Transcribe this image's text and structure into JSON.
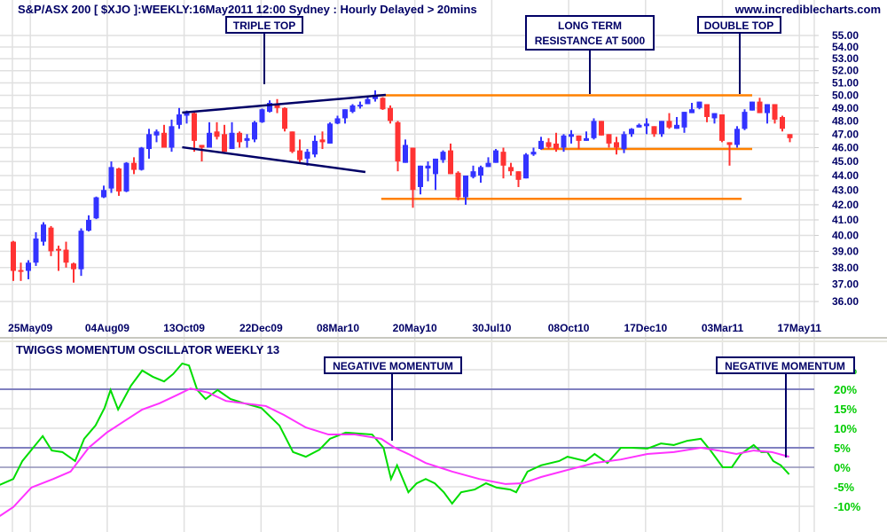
{
  "header": {
    "title": "S&P/ASX 200 [ $XJO ]:WEEKLY:16May2011 12:00 Sydney : Hourly Delayed > 20mins",
    "website": "www.incrediblecharts.com"
  },
  "annotations": {
    "triple_top": "TRIPLE TOP",
    "resistance_line1": "LONG TERM",
    "resistance_line2": "RESISTANCE AT 5000",
    "double_top": "DOUBLE TOP",
    "negative_momentum_1": "NEGATIVE MOMENTUM",
    "negative_momentum_2": "NEGATIVE MOMENTUM"
  },
  "oscillator": {
    "title": "TWIGGS MOMENTUM OSCILLATOR WEEKLY 13"
  },
  "colors": {
    "up": "#3333ff",
    "down": "#ff3333",
    "trendline": "#000066",
    "level": "#ff8000",
    "momentum": "#00dd00",
    "signal": "#ff33ff",
    "osc_level": "#8080c0"
  },
  "chart_data": [
    {
      "type": "candlestick",
      "title": "S&P/ASX 200 [ $XJO ]:WEEKLY",
      "scale": "log",
      "ylim": [
        3600,
        5500
      ],
      "y_ticks": [
        5500,
        5400,
        5300,
        5200,
        5100,
        5000,
        4900,
        4800,
        4700,
        4600,
        4500,
        4400,
        4300,
        4200,
        4100,
        4000,
        3900,
        3800,
        3700,
        3600
      ],
      "y_tick_labels": [
        "55.00",
        "54.00",
        "53.00",
        "52.00",
        "51.00",
        "50.00",
        "49.00",
        "48.00",
        "47.00",
        "46.00",
        "45.00",
        "44.00",
        "43.00",
        "42.00",
        "41.00",
        "40.00",
        "39.00",
        "38.00",
        "37.00",
        "36.00"
      ],
      "x_ticks": [
        1.2,
        11.4,
        21.6,
        31.8,
        42,
        52.2,
        62.4,
        72.6,
        82.8,
        93,
        103.2
      ],
      "x_tick_labels": [
        "25May09",
        "04Aug09",
        "13Oct09",
        "22Dec09",
        "08Mar10",
        "20May10",
        "30Jul10",
        "08Oct10",
        "17Dec10",
        "03Mar11",
        "17May11"
      ],
      "ohlc_fields": [
        "open",
        "high",
        "low",
        "close"
      ],
      "ohlc": [
        [
          3960,
          3965,
          3720,
          3780
        ],
        [
          3785,
          3830,
          3720,
          3775
        ],
        [
          3780,
          3845,
          3730,
          3830
        ],
        [
          3830,
          4020,
          3810,
          3980
        ],
        [
          3960,
          4085,
          3935,
          4070
        ],
        [
          4050,
          4060,
          3870,
          3900
        ],
        [
          3915,
          3935,
          3780,
          3905
        ],
        [
          3910,
          3960,
          3800,
          3830
        ],
        [
          3825,
          3830,
          3710,
          3790
        ],
        [
          3790,
          4045,
          3750,
          4030
        ],
        [
          4030,
          4130,
          4025,
          4100
        ],
        [
          4110,
          4255,
          4105,
          4250
        ],
        [
          4250,
          4330,
          4245,
          4300
        ],
        [
          4310,
          4500,
          4280,
          4460
        ],
        [
          4450,
          4455,
          4260,
          4290
        ],
        [
          4290,
          4495,
          4285,
          4490
        ],
        [
          4490,
          4530,
          4410,
          4440
        ],
        [
          4440,
          4605,
          4435,
          4600
        ],
        [
          4590,
          4740,
          4520,
          4700
        ],
        [
          4690,
          4735,
          4640,
          4720
        ],
        [
          4710,
          4770,
          4600,
          4600
        ],
        [
          4600,
          4810,
          4570,
          4760
        ],
        [
          4770,
          4900,
          4740,
          4850
        ],
        [
          4840,
          4880,
          4780,
          4870
        ],
        [
          4860,
          4870,
          4570,
          4650
        ],
        [
          4620,
          4620,
          4500,
          4600
        ],
        [
          4600,
          4790,
          4600,
          4710
        ],
        [
          4720,
          4790,
          4660,
          4680
        ],
        [
          4700,
          4770,
          4570,
          4570
        ],
        [
          4590,
          4790,
          4590,
          4710
        ],
        [
          4710,
          4720,
          4600,
          4640
        ],
        [
          4650,
          4700,
          4600,
          4670
        ],
        [
          4660,
          4800,
          4640,
          4790
        ],
        [
          4790,
          4895,
          4785,
          4890
        ],
        [
          4870,
          4960,
          4865,
          4940
        ],
        [
          4930,
          4970,
          4860,
          4900
        ],
        [
          4900,
          4905,
          4720,
          4740
        ],
        [
          4720,
          4720,
          4560,
          4570
        ],
        [
          4580,
          4660,
          4490,
          4510
        ],
        [
          4520,
          4590,
          4470,
          4570
        ],
        [
          4550,
          4690,
          4530,
          4650
        ],
        [
          4660,
          4720,
          4590,
          4640
        ],
        [
          4630,
          4790,
          4630,
          4780
        ],
        [
          4780,
          4840,
          4775,
          4820
        ],
        [
          4820,
          4890,
          4780,
          4890
        ],
        [
          4870,
          4930,
          4860,
          4920
        ],
        [
          4915,
          4950,
          4895,
          4925
        ],
        [
          4930,
          4985,
          4930,
          4970
        ],
        [
          4970,
          5040,
          4950,
          5005
        ],
        [
          4980,
          4985,
          4885,
          4890
        ],
        [
          4900,
          4920,
          4780,
          4800
        ],
        [
          4790,
          4800,
          4430,
          4500
        ],
        [
          4490,
          4660,
          4490,
          4620
        ],
        [
          4600,
          4600,
          4180,
          4300
        ],
        [
          4320,
          4470,
          4270,
          4470
        ],
        [
          4450,
          4500,
          4360,
          4470
        ],
        [
          4410,
          4520,
          4300,
          4520
        ],
        [
          4510,
          4580,
          4490,
          4570
        ],
        [
          4580,
          4630,
          4410,
          4410
        ],
        [
          4420,
          4430,
          4230,
          4250
        ],
        [
          4250,
          4400,
          4200,
          4400
        ],
        [
          4390,
          4470,
          4380,
          4430
        ],
        [
          4400,
          4470,
          4350,
          4460
        ],
        [
          4460,
          4530,
          4460,
          4490
        ],
        [
          4490,
          4590,
          4490,
          4580
        ],
        [
          4570,
          4600,
          4380,
          4470
        ],
        [
          4460,
          4490,
          4400,
          4430
        ],
        [
          4430,
          4430,
          4320,
          4370
        ],
        [
          4380,
          4560,
          4380,
          4550
        ],
        [
          4550,
          4600,
          4540,
          4570
        ],
        [
          4590,
          4680,
          4585,
          4650
        ],
        [
          4640,
          4670,
          4590,
          4605
        ],
        [
          4630,
          4710,
          4570,
          4590
        ],
        [
          4600,
          4700,
          4570,
          4690
        ],
        [
          4680,
          4730,
          4630,
          4700
        ],
        [
          4690,
          4690,
          4590,
          4650
        ],
        [
          4650,
          4720,
          4650,
          4670
        ],
        [
          4670,
          4820,
          4660,
          4800
        ],
        [
          4800,
          4800,
          4690,
          4690
        ],
        [
          4700,
          4700,
          4600,
          4630
        ],
        [
          4640,
          4680,
          4550,
          4600
        ],
        [
          4590,
          4720,
          4560,
          4700
        ],
        [
          4700,
          4745,
          4680,
          4740
        ],
        [
          4750,
          4780,
          4750,
          4770
        ],
        [
          4760,
          4820,
          4700,
          4780
        ],
        [
          4760,
          4760,
          4680,
          4700
        ],
        [
          4700,
          4800,
          4680,
          4800
        ],
        [
          4800,
          4860,
          4740,
          4750
        ],
        [
          4740,
          4830,
          4740,
          4770
        ],
        [
          4750,
          4870,
          4710,
          4870
        ],
        [
          4860,
          4940,
          4860,
          4890
        ],
        [
          4900,
          4950,
          4890,
          4950
        ],
        [
          4930,
          4930,
          4790,
          4830
        ],
        [
          4820,
          4860,
          4780,
          4860
        ],
        [
          4850,
          4850,
          4640,
          4650
        ],
        [
          4640,
          4640,
          4470,
          4620
        ],
        [
          4620,
          4760,
          4600,
          4740
        ],
        [
          4740,
          4890,
          4730,
          4870
        ],
        [
          4880,
          4950,
          4880,
          4950
        ],
        [
          4950,
          4980,
          4860,
          4860
        ],
        [
          4860,
          4930,
          4780,
          4930
        ],
        [
          4930,
          4930,
          4780,
          4810
        ],
        [
          4830,
          4840,
          4720,
          4740
        ],
        [
          4700,
          4700,
          4640,
          4670
        ]
      ],
      "trendlines": [
        {
          "name": "triple-top-upper",
          "from": [
            22.4,
            4864
          ],
          "to": [
            49.4,
            5003
          ]
        },
        {
          "name": "triple-top-lower",
          "from": [
            22.4,
            4603
          ],
          "to": [
            46.7,
            4425
          ]
        }
      ],
      "levels": [
        {
          "name": "resistance-5000",
          "value": 5000,
          "from": 48.2,
          "to": 98
        },
        {
          "name": "support-4590",
          "value": 4590,
          "from": 70,
          "to": 98
        },
        {
          "name": "support-4240",
          "value": 4240,
          "from": 48.8,
          "to": 96.6
        }
      ]
    },
    {
      "type": "line",
      "title": "TWIGGS MOMENTUM OSCILLATOR WEEKLY 13",
      "ylim": [
        -13,
        27
      ],
      "y_ticks": [
        25,
        20,
        15,
        10,
        5,
        0,
        -5,
        -10
      ],
      "y_tick_labels": [
        "25%",
        "20%",
        "15%",
        "10%",
        "5%",
        "0%",
        "-5%",
        "-10%"
      ],
      "reference_lines": [
        20,
        5,
        0
      ],
      "series": [
        {
          "name": "momentum",
          "points": [
            [
              -1.8,
              -4.5
            ],
            [
              0,
              -3
            ],
            [
              1.2,
              1.6
            ],
            [
              3.9,
              8
            ],
            [
              5.1,
              4.3
            ],
            [
              6.5,
              3.9
            ],
            [
              8.2,
              1.6
            ],
            [
              9.4,
              7.3
            ],
            [
              10.9,
              10.7
            ],
            [
              12.1,
              15.2
            ],
            [
              12.9,
              19.8
            ],
            [
              13.9,
              14.8
            ],
            [
              15.6,
              20.9
            ],
            [
              17.1,
              24.8
            ],
            [
              18.5,
              23.2
            ],
            [
              20,
              22
            ],
            [
              21.2,
              23.9
            ],
            [
              22.4,
              26.6
            ],
            [
              23.3,
              26.1
            ],
            [
              24.4,
              19.8
            ],
            [
              25.5,
              17.5
            ],
            [
              27.1,
              19.8
            ],
            [
              28.8,
              17.5
            ],
            [
              30.6,
              16.4
            ],
            [
              32.9,
              15.2
            ],
            [
              35.3,
              10.7
            ],
            [
              37.1,
              3.9
            ],
            [
              38.8,
              2.7
            ],
            [
              40.6,
              4.5
            ],
            [
              42,
              7.3
            ],
            [
              44.1,
              8.9
            ],
            [
              47.6,
              8.4
            ],
            [
              49.1,
              5
            ],
            [
              50.1,
              -3
            ],
            [
              50.9,
              0.5
            ],
            [
              52.4,
              -6.4
            ],
            [
              53.5,
              -4.1
            ],
            [
              54.7,
              -3
            ],
            [
              55.9,
              -4.1
            ],
            [
              57.1,
              -6.4
            ],
            [
              58.2,
              -9.3
            ],
            [
              59.4,
              -6.4
            ],
            [
              61.2,
              -5.7
            ],
            [
              62.7,
              -4.1
            ],
            [
              64.1,
              -5.2
            ],
            [
              65.9,
              -5.7
            ],
            [
              66.7,
              -6.4
            ],
            [
              68.2,
              -1.1
            ],
            [
              70,
              0.5
            ],
            [
              72.4,
              1.6
            ],
            [
              73.5,
              2.7
            ],
            [
              75.9,
              1.6
            ],
            [
              77.1,
              3.4
            ],
            [
              78.8,
              1.1
            ],
            [
              80.6,
              5
            ],
            [
              82,
              5
            ],
            [
              84.1,
              4.8
            ],
            [
              85.9,
              6.1
            ],
            [
              87.6,
              5.7
            ],
            [
              89.4,
              6.8
            ],
            [
              91.2,
              7.3
            ],
            [
              92.4,
              4.5
            ],
            [
              94.1,
              0
            ],
            [
              95.3,
              0
            ],
            [
              96.5,
              3.4
            ],
            [
              98.2,
              5.7
            ],
            [
              99.2,
              3.9
            ],
            [
              100,
              3.9
            ],
            [
              100.8,
              1.6
            ],
            [
              101.8,
              0.5
            ],
            [
              102.9,
              -1.8
            ]
          ]
        },
        {
          "name": "signal",
          "points": [
            [
              -1.8,
              -12.5
            ],
            [
              0,
              -10.2
            ],
            [
              2.4,
              -5.2
            ],
            [
              5.3,
              -3
            ],
            [
              7.6,
              -1.1
            ],
            [
              10,
              5
            ],
            [
              12.4,
              8.9
            ],
            [
              14.7,
              11.8
            ],
            [
              17.1,
              14.8
            ],
            [
              19.4,
              16.4
            ],
            [
              21.8,
              18.6
            ],
            [
              23.5,
              20.2
            ],
            [
              25.9,
              19.1
            ],
            [
              28.2,
              17
            ],
            [
              30.6,
              16.4
            ],
            [
              33.5,
              15.7
            ],
            [
              35.9,
              13.4
            ],
            [
              38.8,
              10.2
            ],
            [
              41.8,
              8.4
            ],
            [
              45.3,
              8.4
            ],
            [
              48.8,
              7.3
            ],
            [
              50.6,
              5
            ],
            [
              52.4,
              3.4
            ],
            [
              54.7,
              1.1
            ],
            [
              58.2,
              -1.1
            ],
            [
              61.8,
              -3
            ],
            [
              65.3,
              -4.3
            ],
            [
              67.6,
              -4.1
            ],
            [
              70,
              -2.5
            ],
            [
              73.5,
              -0.7
            ],
            [
              77.1,
              1.1
            ],
            [
              80.6,
              2
            ],
            [
              84.1,
              3.4
            ],
            [
              87.6,
              3.9
            ],
            [
              91.2,
              5
            ],
            [
              93.5,
              4.3
            ],
            [
              95.9,
              3.4
            ],
            [
              98.2,
              4.3
            ],
            [
              100.6,
              3.9
            ],
            [
              102.9,
              2.7
            ]
          ]
        }
      ]
    }
  ]
}
